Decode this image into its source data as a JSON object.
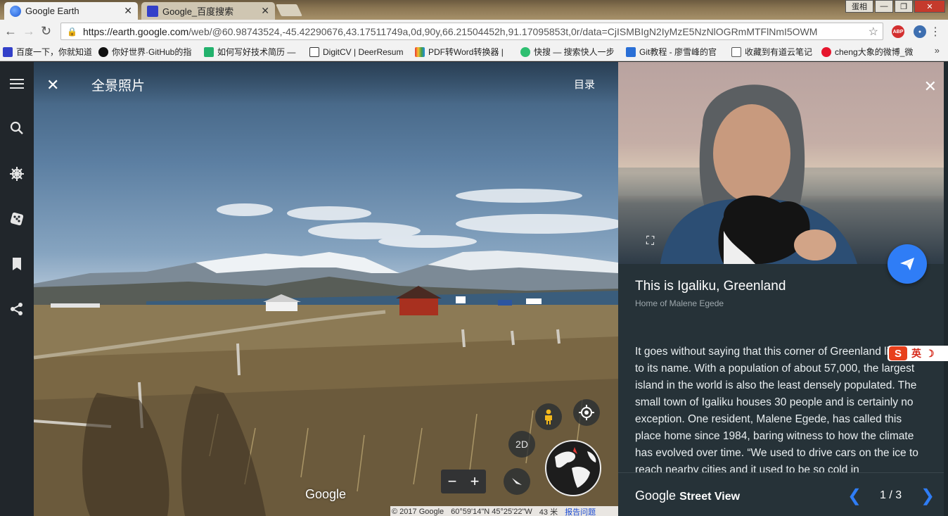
{
  "browser": {
    "tabs": [
      {
        "title": "Google Earth",
        "active": true
      },
      {
        "title": "Google_百度搜索",
        "active": false
      }
    ],
    "user_button": "蛋相",
    "url_host": "https://earth.google.com",
    "url_path": "/web/@60.98743524,-45.42290676,43.17511749a,0d,90y,66.21504452h,91.17095853t,0r/data=CjISMBIgN2IyMzE5NzNlOGRmMTFlNmI5OWM",
    "extensions": [
      "ABP"
    ],
    "bookmarks": [
      "百度一下，你就知道",
      "你好世界·GitHub的指",
      "如何写好技术简历 —",
      "DigitCV | DeerResum",
      "PDF转Word转换器 |",
      "快搜 — 搜索快人一步",
      "Git教程 - 廖雪峰的官",
      "收藏到有道云笔记",
      "cheng大象的微博_微"
    ],
    "bookmarks_more": "»"
  },
  "viewer": {
    "title": "全景照片",
    "catalog": "目录",
    "mode_2d": "2D",
    "zoom_minus": "−",
    "zoom_plus": "+",
    "google_logo": "Google",
    "copyright": "© 2017 Google",
    "coordinates": "60°59'14\"N 45°25'22\"W",
    "scale": "43 米",
    "report": "报告问题"
  },
  "story": {
    "title": "This is Igaliku, Greenland",
    "subtitle": "Home of Malene Egede",
    "body": "It goes without saying that this corner of Greenland lives up to its name. With a population of about 57,000, the largest island in the world is also the least densely populated. The small town of Igaliku houses 30 people and is certainly no exception. One resident, Malene Egede, has called this place home since 1984, baring witness to how the climate has evolved over time. “We used to drive cars on the ice to reach nearby cities and it used to be so cold in",
    "footer_google": "Google",
    "footer_streetview": "Street View",
    "page": "1 / 3"
  },
  "ime": {
    "label": "英"
  },
  "colors": {
    "accent": "#2f7df6",
    "rail": "#21262b",
    "panel": "#263238"
  }
}
